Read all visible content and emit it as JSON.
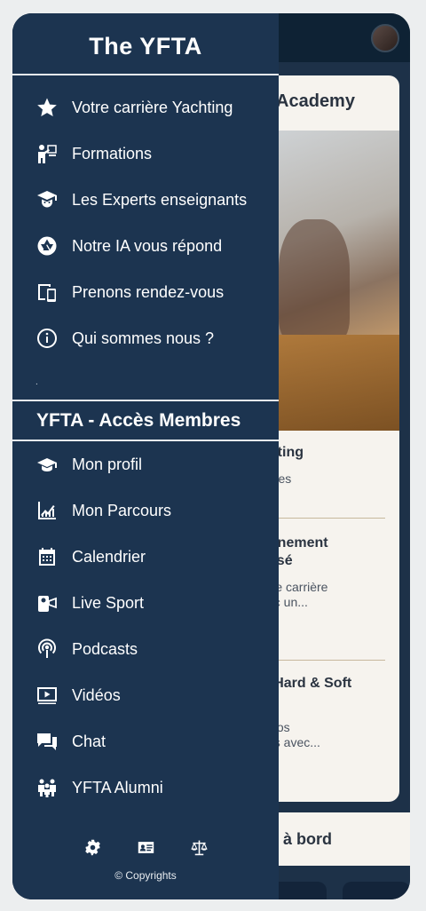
{
  "drawer": {
    "title": "The YFTA",
    "main_items": [
      {
        "label": "Votre carrière Yachting",
        "icon": "star-icon"
      },
      {
        "label": "Formations",
        "icon": "teacher-icon"
      },
      {
        "label": "Les Experts enseignants",
        "icon": "graduate-icon"
      },
      {
        "label": "Notre IA vous répond",
        "icon": "aperture-icon"
      },
      {
        "label": "Prenons rendez-vous",
        "icon": "devices-icon"
      },
      {
        "label": "Qui sommes nous ?",
        "icon": "info-icon"
      }
    ],
    "dot": ".",
    "members_title": "YFTA - Accès Membres",
    "member_items": [
      {
        "label": "Mon profil",
        "icon": "mortarboard-icon"
      },
      {
        "label": "Mon Parcours",
        "icon": "chart-icon"
      },
      {
        "label": "Calendrier",
        "icon": "calendar-icon"
      },
      {
        "label": "Live Sport",
        "icon": "camera-icon"
      },
      {
        "label": "Podcasts",
        "icon": "podcast-icon"
      },
      {
        "label": "Vidéos",
        "icon": "video-icon"
      },
      {
        "label": "Chat",
        "icon": "chat-icon"
      },
      {
        "label": "YFTA Alumni",
        "icon": "group-icon"
      }
    ],
    "footer_icons": [
      "gear-icon",
      "id-card-icon",
      "scales-icon"
    ],
    "copyright": "© Copyrights"
  },
  "background": {
    "card_title": "h Academy",
    "section1_title": "chting",
    "section1_text": "ur les",
    "section2_title_l1": "agnement",
    "section2_title_l2": "alisé",
    "section2_text_l1": "otre carrière",
    "section2_text_l2": "vec un...",
    "section3_title": "n Hard & Soft",
    "section3_text_l1": "z vos",
    "section3_text_l2": "ces avec...",
    "bottom_label": "à bord"
  },
  "colors": {
    "drawer_bg": "#1c3450",
    "app_bg": "#1d3148",
    "card_bg": "#f6f3ee",
    "text_white": "#ffffff"
  }
}
